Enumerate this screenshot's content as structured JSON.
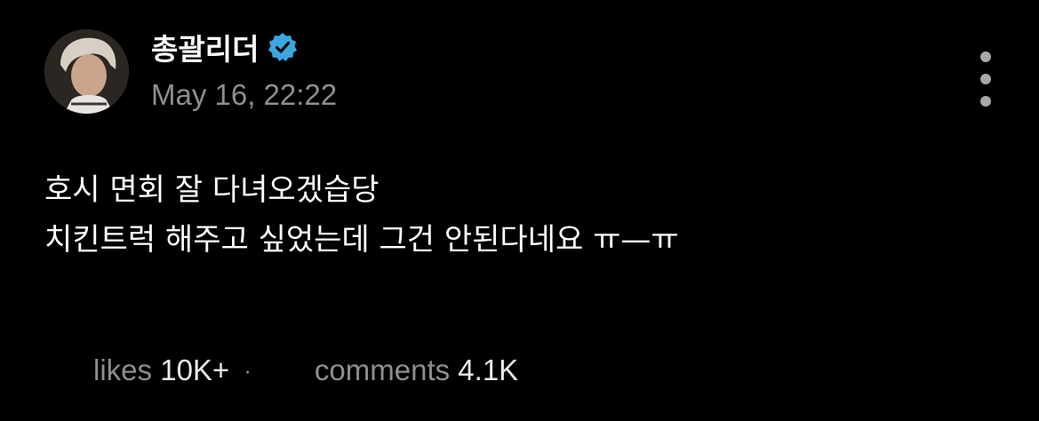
{
  "post": {
    "author": {
      "name": "총괄리더",
      "verified_icon": "verified-badge-icon",
      "verified_color": "#3ba7e0"
    },
    "timestamp": "May 16, 22:22",
    "menu_icon": "more-vertical-icon",
    "body_lines": [
      "호시 면회 잘 다녀오겠습당",
      "치킨트럭 해주고 싶었는데 그건 안된다네요 ㅠ—ㅠ"
    ],
    "stats": {
      "likes_label": "likes",
      "likes_value": "10K+",
      "separator": "·",
      "comments_label": "comments",
      "comments_value": "4.1K"
    }
  }
}
